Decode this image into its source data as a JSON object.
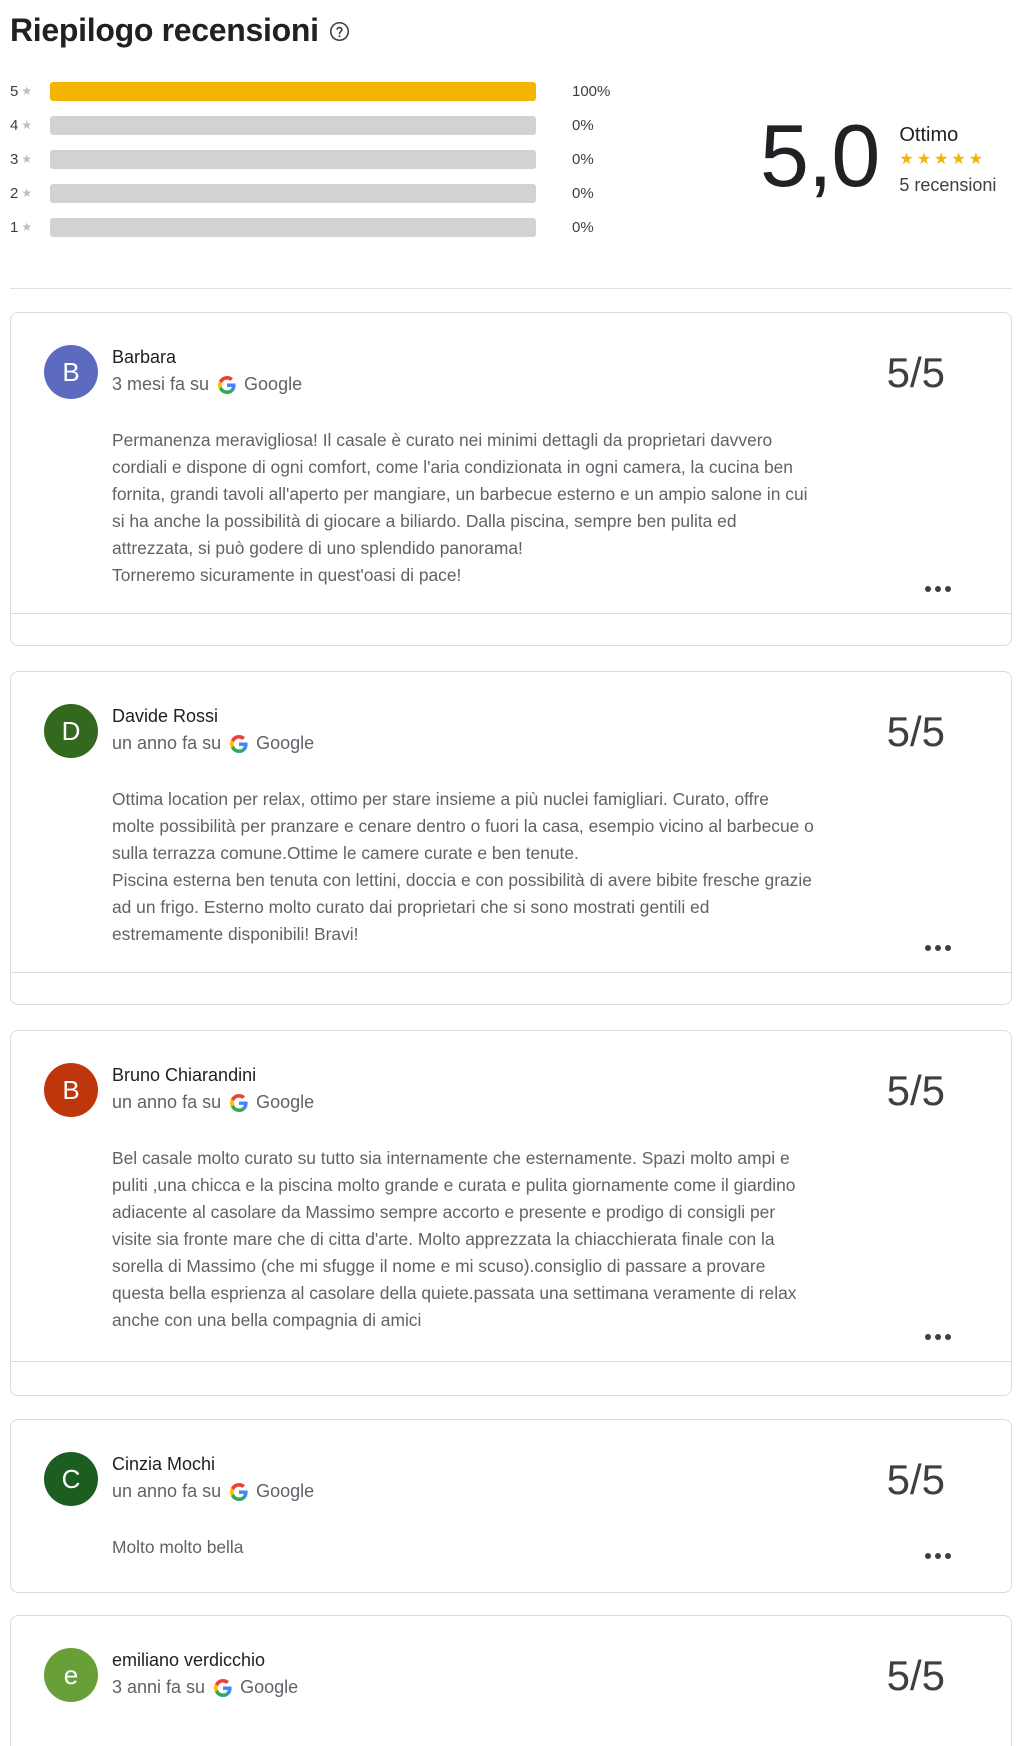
{
  "summary": {
    "title": "Riepilogo recensioni",
    "distribution": [
      {
        "stars": "5",
        "percent_label": "100%",
        "fraction": 1.0
      },
      {
        "stars": "4",
        "percent_label": "0%",
        "fraction": 0.0
      },
      {
        "stars": "3",
        "percent_label": "0%",
        "fraction": 0.0
      },
      {
        "stars": "2",
        "percent_label": "0%",
        "fraction": 0.0
      },
      {
        "stars": "1",
        "percent_label": "0%",
        "fraction": 0.0
      }
    ],
    "score": "5,0",
    "rating_word": "Ottimo",
    "star_rating": 5,
    "review_count": "5 recensioni"
  },
  "colors": {
    "accent_star": "#f4b400",
    "bar_empty": "#d2d2d2"
  },
  "icons": {
    "help": "help-circle-icon",
    "google": "google-g-icon",
    "more": "more-horizontal-icon",
    "star": "star-icon"
  },
  "reviews": [
    {
      "initial": "B",
      "avatar_color": "#5c6bc0",
      "author": "Barbara",
      "time": "3 mesi fa su",
      "source": "Google",
      "score": "5/5",
      "text": "Permanenza meravigliosa! Il casale è curato nei minimi dettagli da proprietari davvero\ncordiali e dispone di ogni comfort, come l'aria condizionata in ogni camera, la cucina ben\nfornita, grandi tavoli all'aperto per mangiare, un barbecue esterno e un ampio salone in cui\nsi ha anche la possibilità di giocare a biliardo. Dalla piscina, sempre ben pulita ed\nattrezzata, si può godere di uno splendido panorama!\nTorneremo sicuramente in quest'oasi di pace!"
    },
    {
      "initial": "D",
      "avatar_color": "#33691e",
      "author": "Davide Rossi",
      "time": "un anno fa su",
      "source": "Google",
      "score": "5/5",
      "text": "Ottima location per relax, ottimo per stare insieme a più nuclei famigliari. Curato, offre\nmolte possibilità per pranzare e cenare dentro o fuori la casa, esempio vicino al barbecue o\nsulla terrazza comune.Ottime le camere curate e ben tenute.\nPiscina esterna ben tenuta con lettini, doccia e con possibilità di avere bibite fresche grazie\nad un frigo. Esterno molto curato dai proprietari che si sono mostrati gentili ed\nestremamente disponibili! Bravi!"
    },
    {
      "initial": "B",
      "avatar_color": "#bf360c",
      "author": "Bruno Chiarandini",
      "time": "un anno fa su",
      "source": "Google",
      "score": "5/5",
      "text": "Bel casale molto curato su tutto sia internamente che esternamente. Spazi molto ampi e\npuliti ,una chicca e la piscina molto grande e curata e pulita giornamente come il giardino\nadiacente al casolare da Massimo sempre accorto e presente e prodigo di consigli per\nvisite sia fronte mare che di citta d'arte. Molto apprezzata la chiacchierata finale con la\nsorella di Massimo (che mi sfugge il nome e mi scuso).consiglio di passare a provare\nquesta bella esprienza al casolare della quiete.passata una settimana veramente di relax\nanche con una bella compagnia di amici"
    },
    {
      "initial": "C",
      "avatar_color": "#1b5e20",
      "author": "Cinzia Mochi",
      "time": "un anno fa su",
      "source": "Google",
      "score": "5/5",
      "text": "Molto molto bella"
    },
    {
      "initial": "e",
      "avatar_color": "#689f38",
      "author": "emiliano verdicchio",
      "time": "3 anni fa su",
      "source": "Google",
      "score": "5/5",
      "text": ""
    }
  ]
}
